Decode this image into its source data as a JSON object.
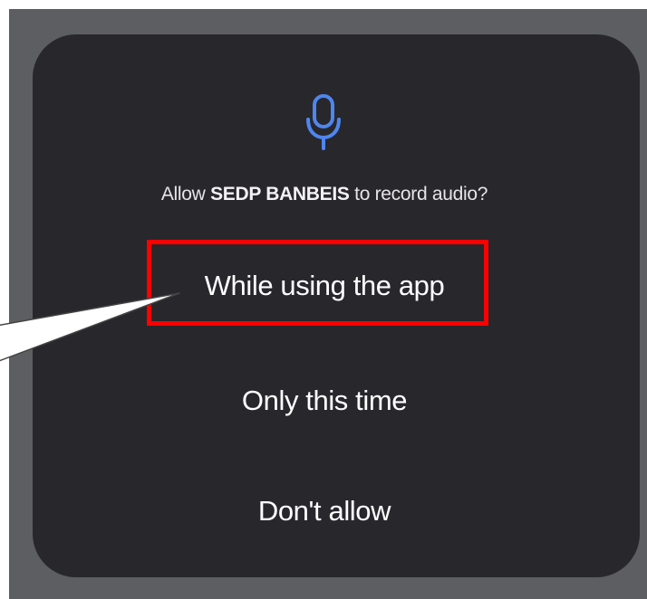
{
  "dialog": {
    "icon": "microphone-icon",
    "prompt": {
      "prefix": "Allow ",
      "app_name": "SEDP BANBEIS",
      "suffix": " to record audio?"
    },
    "options": [
      {
        "label": "While using the app",
        "highlighted": true
      },
      {
        "label": "Only this time",
        "highlighted": false
      },
      {
        "label": "Don't allow",
        "highlighted": false
      }
    ]
  },
  "annotation": {
    "highlight_color": "#ff0000",
    "callout_icon": "callout-pointer"
  },
  "colors": {
    "dialog_bg": "#28272c",
    "backdrop": "#5d5e62",
    "accent": "#4f86ee",
    "text": "#ffffff"
  }
}
